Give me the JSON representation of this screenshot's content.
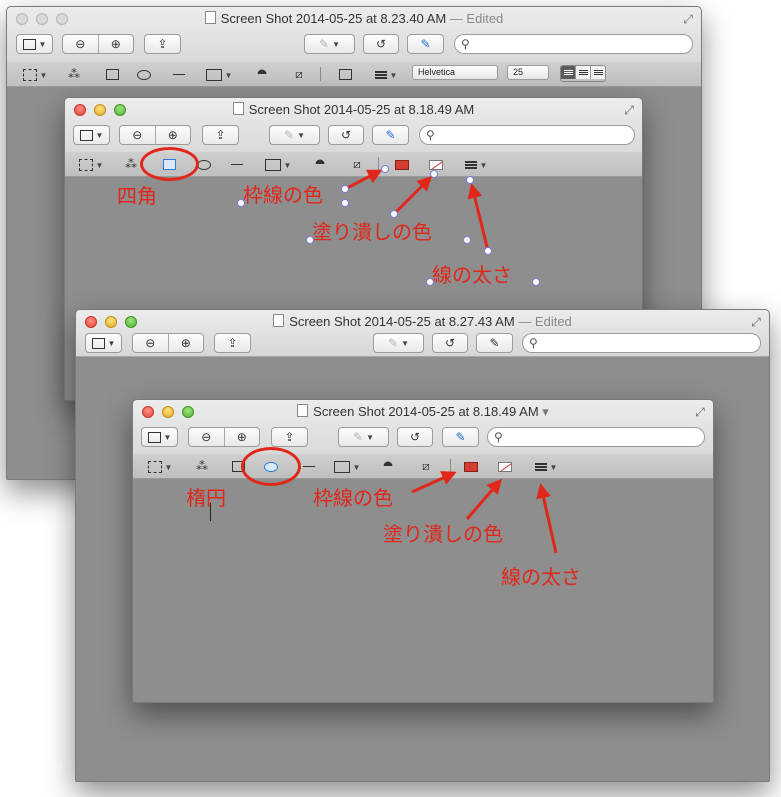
{
  "common": {
    "zoom_out_glyph": "⊖",
    "zoom_in_glyph": "⊕",
    "share_glyph": "⇪",
    "rotate_glyph": "↺",
    "markup_glyph": "✎",
    "search_glyph": "⚲",
    "fullscreen_glyph": "⤢",
    "dropdown_glyph": "▼",
    "magic_glyph": "⁂",
    "shape_glyph": "⯊",
    "crop_glyph": "⧄"
  },
  "back_window": {
    "title": "Screen Shot 2014-05-25 at 8.23.40 AM",
    "status": "— Edited",
    "font_name": "Helvetica",
    "font_size": "25"
  },
  "window_a": {
    "title": "Screen Shot 2014-05-25 at 8.18.49 AM"
  },
  "window_b": {
    "title": "Screen Shot 2014-05-25 at 8.27.43 AM",
    "status": "— Edited"
  },
  "window_c": {
    "title": "Screen Shot 2014-05-25 at 8.18.49 AM",
    "title_menu_glyph": "▾"
  },
  "annotations_a": {
    "rectangle": "四角",
    "border_color": "枠線の色",
    "fill_color": "塗り潰しの色",
    "line_width": "線の太さ"
  },
  "annotations_c": {
    "ellipse": "楕円",
    "border_color": "枠線の色",
    "fill_color": "塗り潰しの色",
    "line_width": "線の太さ"
  },
  "colors": {
    "annotation_red": "#e0271a",
    "selection_blue": "#2e7ad6",
    "window_content_gray": "#8e8e8e"
  }
}
